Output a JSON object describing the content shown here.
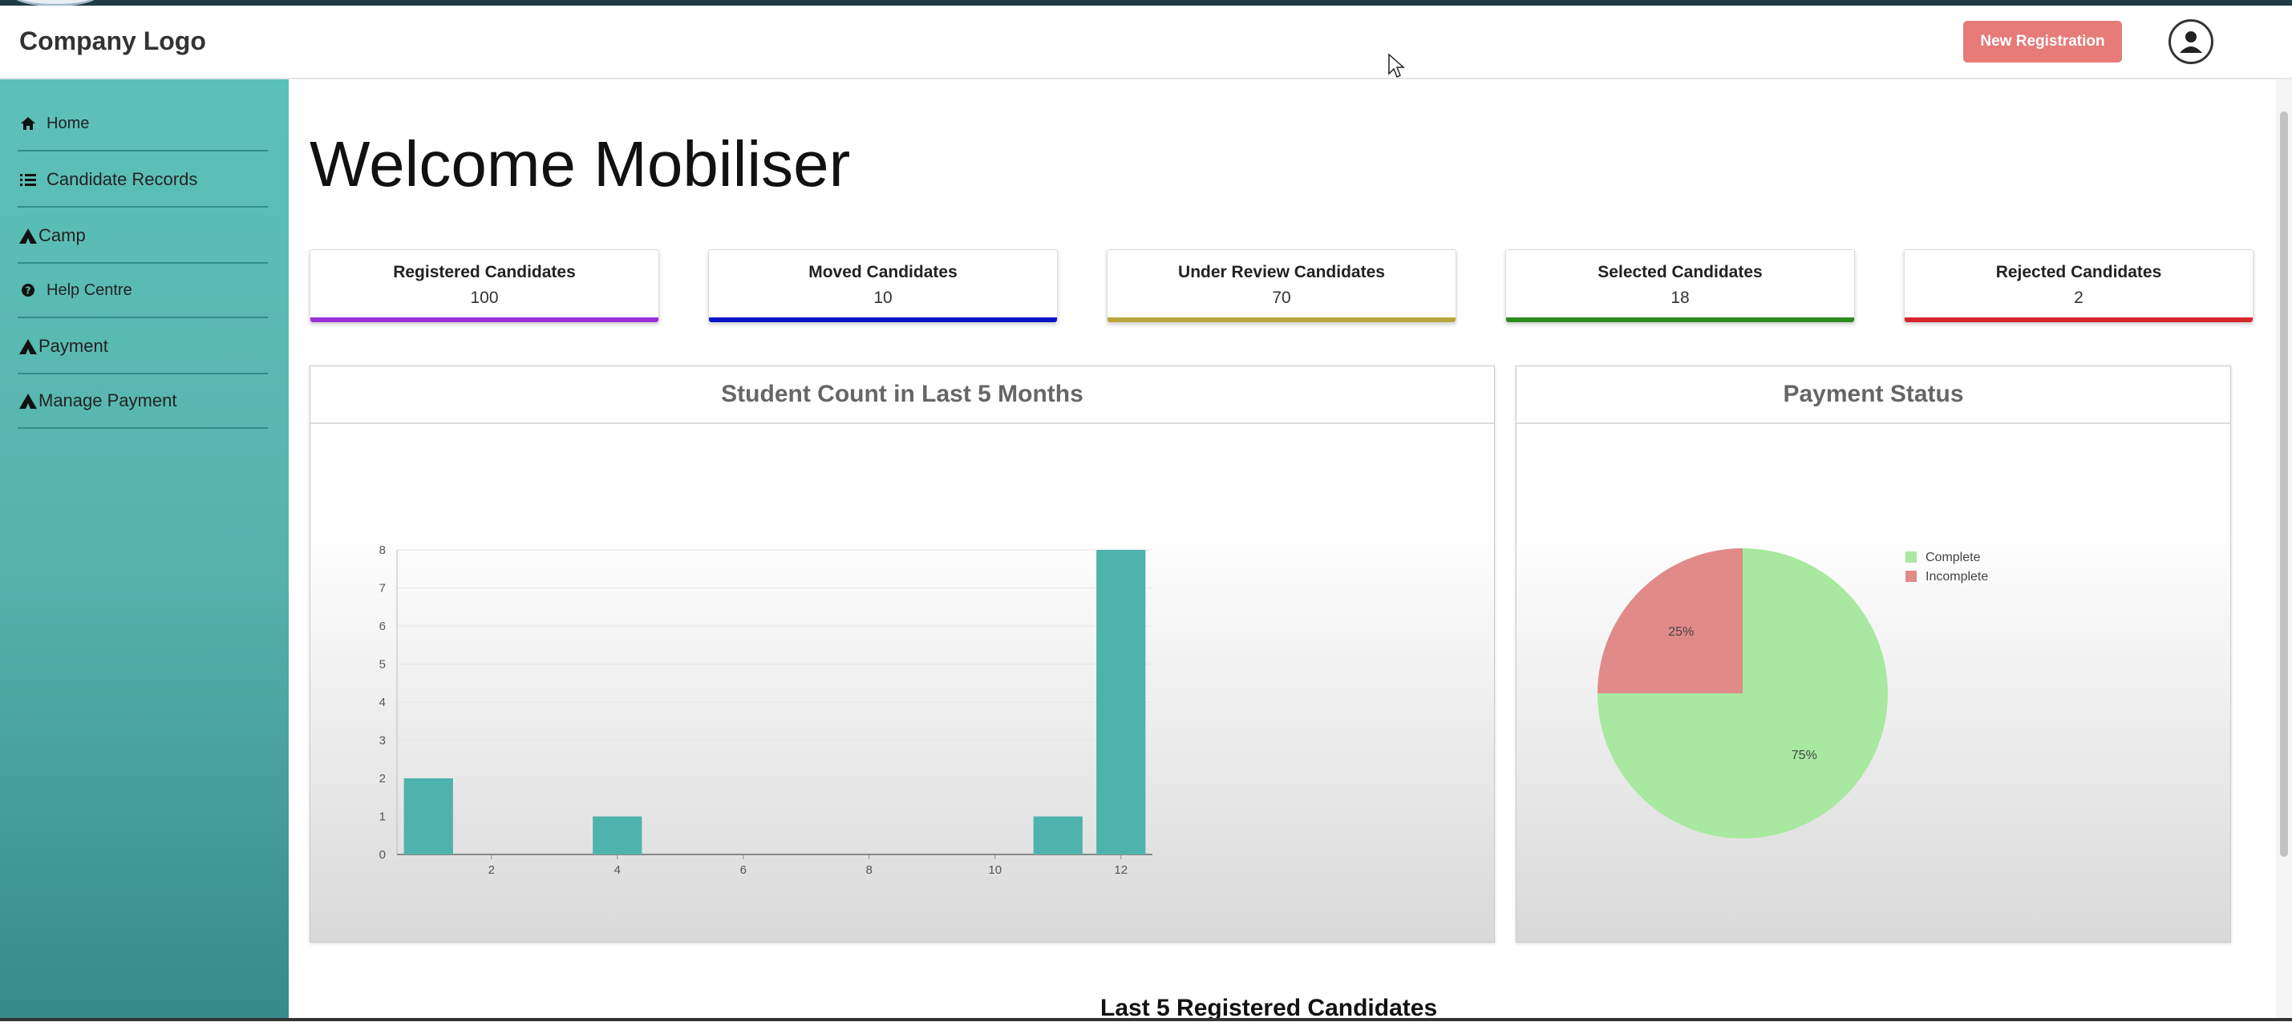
{
  "header": {
    "logo": "Company Logo",
    "new_registration": "New Registration",
    "avatar_icon": "user-circle-icon"
  },
  "sidebar": {
    "items": [
      {
        "label": "Home",
        "icon": "home-icon"
      },
      {
        "label": "Candidate Records",
        "icon": "list-icon"
      },
      {
        "label": "Camp",
        "icon": "camp-icon"
      },
      {
        "label": "Help Centre",
        "icon": "help-icon"
      },
      {
        "label": "Payment",
        "icon": "camp-icon"
      },
      {
        "label": "Manage Payment",
        "icon": "camp-icon"
      }
    ]
  },
  "main": {
    "welcome": "Welcome Mobiliser",
    "stats": [
      {
        "label": "Registered Candidates",
        "value": "100",
        "color": "#9b30d9"
      },
      {
        "label": "Moved Candidates",
        "value": "10",
        "color": "#0a14c8"
      },
      {
        "label": "Under Review Candidates",
        "value": "70",
        "color": "#b9a53e"
      },
      {
        "label": "Selected Candidates",
        "value": "18",
        "color": "#2e8b22"
      },
      {
        "label": "Rejected Candidates",
        "value": "2",
        "color": "#d7262b"
      }
    ],
    "bar_card_title": "Student Count in Last 5 Months",
    "pie_card_title": "Payment Status",
    "last_section_title": "Last 5 Registered Candidates"
  },
  "chart_data": [
    {
      "type": "bar",
      "title": "Student Count in Last 5 Months",
      "x": [
        1,
        4,
        11,
        12
      ],
      "values": [
        2,
        1,
        1,
        8
      ],
      "xticks": [
        "2",
        "4",
        "6",
        "8",
        "10",
        "12"
      ],
      "yticks": [
        "0",
        "1",
        "2",
        "3",
        "4",
        "5",
        "6",
        "7",
        "8"
      ],
      "ylim": [
        0,
        8
      ],
      "xlim": [
        0.5,
        12.5
      ],
      "grid": true,
      "color": "#4fb3ad"
    },
    {
      "type": "pie",
      "title": "Payment Status",
      "labels": [
        "Complete",
        "Incomplete"
      ],
      "values": [
        75,
        25
      ],
      "percent_labels": [
        "75%",
        "25%"
      ],
      "colors": [
        "#a8e8a0",
        "#e08a8a"
      ],
      "legend": "top-right"
    }
  ]
}
